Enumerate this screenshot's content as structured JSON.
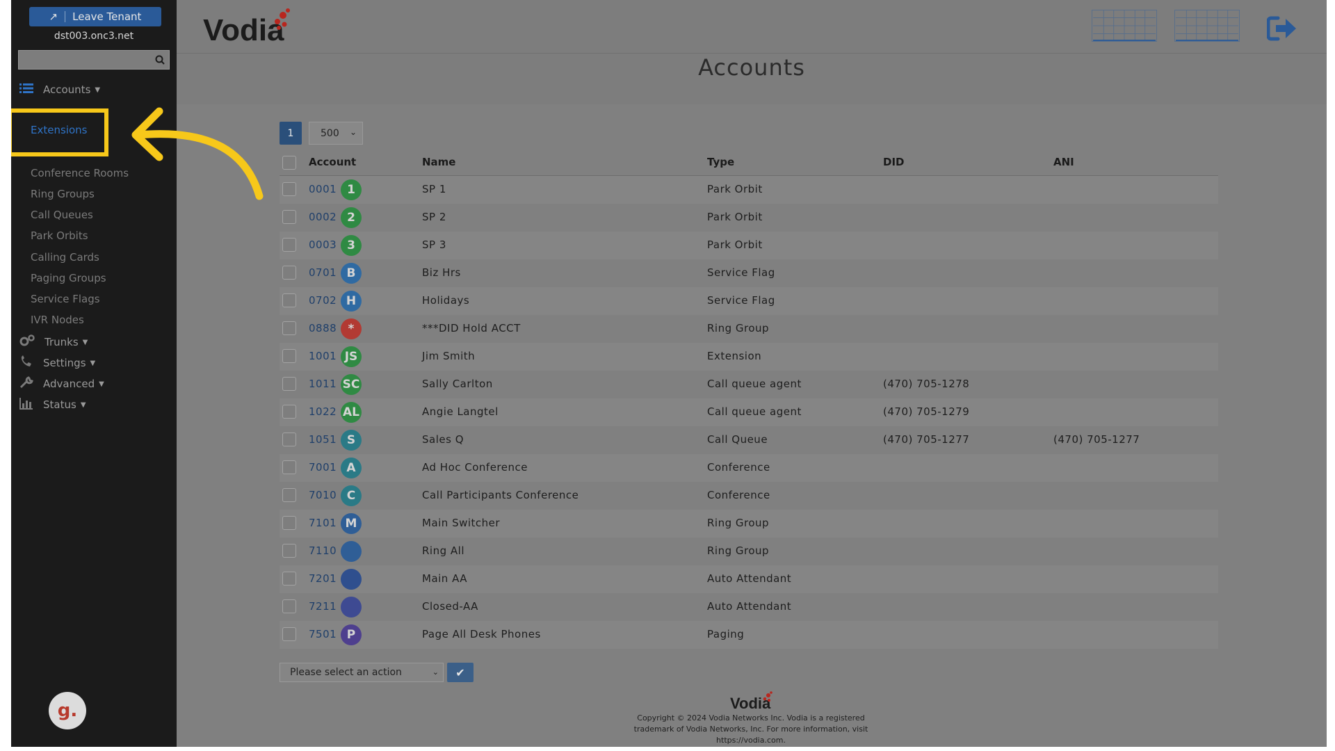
{
  "sidebar": {
    "leave_tenant": "Leave Tenant",
    "tenant": "dst003.onc3.net",
    "search_value": "",
    "sections": [
      {
        "label": "Accounts",
        "icon": "list-icon"
      },
      {
        "label": "Trunks",
        "icon": "gears-icon"
      },
      {
        "label": "Settings",
        "icon": "phone-icon"
      },
      {
        "label": "Advanced",
        "icon": "wrench-icon"
      },
      {
        "label": "Status",
        "icon": "bar-chart-icon"
      }
    ],
    "account_items": [
      "Extensions",
      "Conference Rooms",
      "Ring Groups",
      "Call Queues",
      "Park Orbits",
      "Calling Cards",
      "Paging Groups",
      "Service Flags",
      "IVR Nodes"
    ],
    "active_item": "Extensions",
    "helper_avatar": "g."
  },
  "header": {
    "logo": "Vodia",
    "icons": [
      "grid-icon",
      "grid-icon",
      "logout-icon"
    ]
  },
  "page": {
    "title": "Accounts",
    "current_page": "1",
    "per_page": "500"
  },
  "table": {
    "headers": {
      "account": "Account",
      "name": "Name",
      "type": "Type",
      "did": "DID",
      "ani": "ANI"
    },
    "rows": [
      {
        "account": "0001",
        "badge": "1",
        "color": "#2f8a43",
        "name": "SP 1",
        "type": "Park Orbit",
        "did": "",
        "ani": ""
      },
      {
        "account": "0002",
        "badge": "2",
        "color": "#2f8a43",
        "name": "SP 2",
        "type": "Park Orbit",
        "did": "",
        "ani": ""
      },
      {
        "account": "0003",
        "badge": "3",
        "color": "#2f8a43",
        "name": "SP 3",
        "type": "Park Orbit",
        "did": "",
        "ani": ""
      },
      {
        "account": "0701",
        "badge": "B",
        "color": "#2f6aa2",
        "name": "Biz Hrs",
        "type": "Service Flag",
        "did": "",
        "ani": ""
      },
      {
        "account": "0702",
        "badge": "H",
        "color": "#2f6aa2",
        "name": "Holidays",
        "type": "Service Flag",
        "did": "",
        "ani": ""
      },
      {
        "account": "0888",
        "badge": "*",
        "color": "#b23a33",
        "name": "***DID Hold ACCT",
        "type": "Ring Group",
        "did": "",
        "ani": ""
      },
      {
        "account": "1001",
        "badge": "JS",
        "color": "#2f8a43",
        "name": "Jim Smith",
        "type": "Extension",
        "did": "",
        "ani": ""
      },
      {
        "account": "1011",
        "badge": "SC",
        "color": "#2f8a43",
        "name": "Sally Carlton",
        "type": "Call queue agent",
        "did": "(470) 705-1278",
        "ani": ""
      },
      {
        "account": "1022",
        "badge": "AL",
        "color": "#2f8a43",
        "name": "Angie Langtel",
        "type": "Call queue agent",
        "did": "(470) 705-1279",
        "ani": ""
      },
      {
        "account": "1051",
        "badge": "S",
        "color": "#2a7a86",
        "name": "Sales Q",
        "type": "Call Queue",
        "did": "(470) 705-1277",
        "ani": "(470) 705-1277"
      },
      {
        "account": "7001",
        "badge": "A",
        "color": "#2a7a86",
        "name": "Ad Hoc Conference",
        "type": "Conference",
        "did": "",
        "ani": ""
      },
      {
        "account": "7010",
        "badge": "C",
        "color": "#2a7a86",
        "name": "Call Participants Conference",
        "type": "Conference",
        "did": "",
        "ani": ""
      },
      {
        "account": "7101",
        "badge": "M",
        "color": "#2f5e96",
        "name": "Main Switcher",
        "type": "Ring Group",
        "did": "",
        "ani": ""
      },
      {
        "account": "7110",
        "badge": "",
        "color": "#2f5e96",
        "name": "Ring All",
        "type": "Ring Group",
        "did": "",
        "ani": ""
      },
      {
        "account": "7201",
        "badge": "",
        "color": "#2f4f8e",
        "name": "Main AA",
        "type": "Auto Attendant",
        "did": "",
        "ani": ""
      },
      {
        "account": "7211",
        "badge": "",
        "color": "#3e4a92",
        "name": "Closed-AA",
        "type": "Auto Attendant",
        "did": "",
        "ani": ""
      },
      {
        "account": "7501",
        "badge": "P",
        "color": "#4e3f8e",
        "name": "Page All Desk Phones",
        "type": "Paging",
        "did": "",
        "ani": ""
      }
    ]
  },
  "actions": {
    "select_placeholder": "Please select an action"
  },
  "footer": {
    "line1": "Copyright © 2024 Vodia Networks Inc. Vodia is a registered",
    "line2": "trademark of Vodia Networks, Inc. For more information, visit",
    "line3": "https://vodia.com."
  }
}
